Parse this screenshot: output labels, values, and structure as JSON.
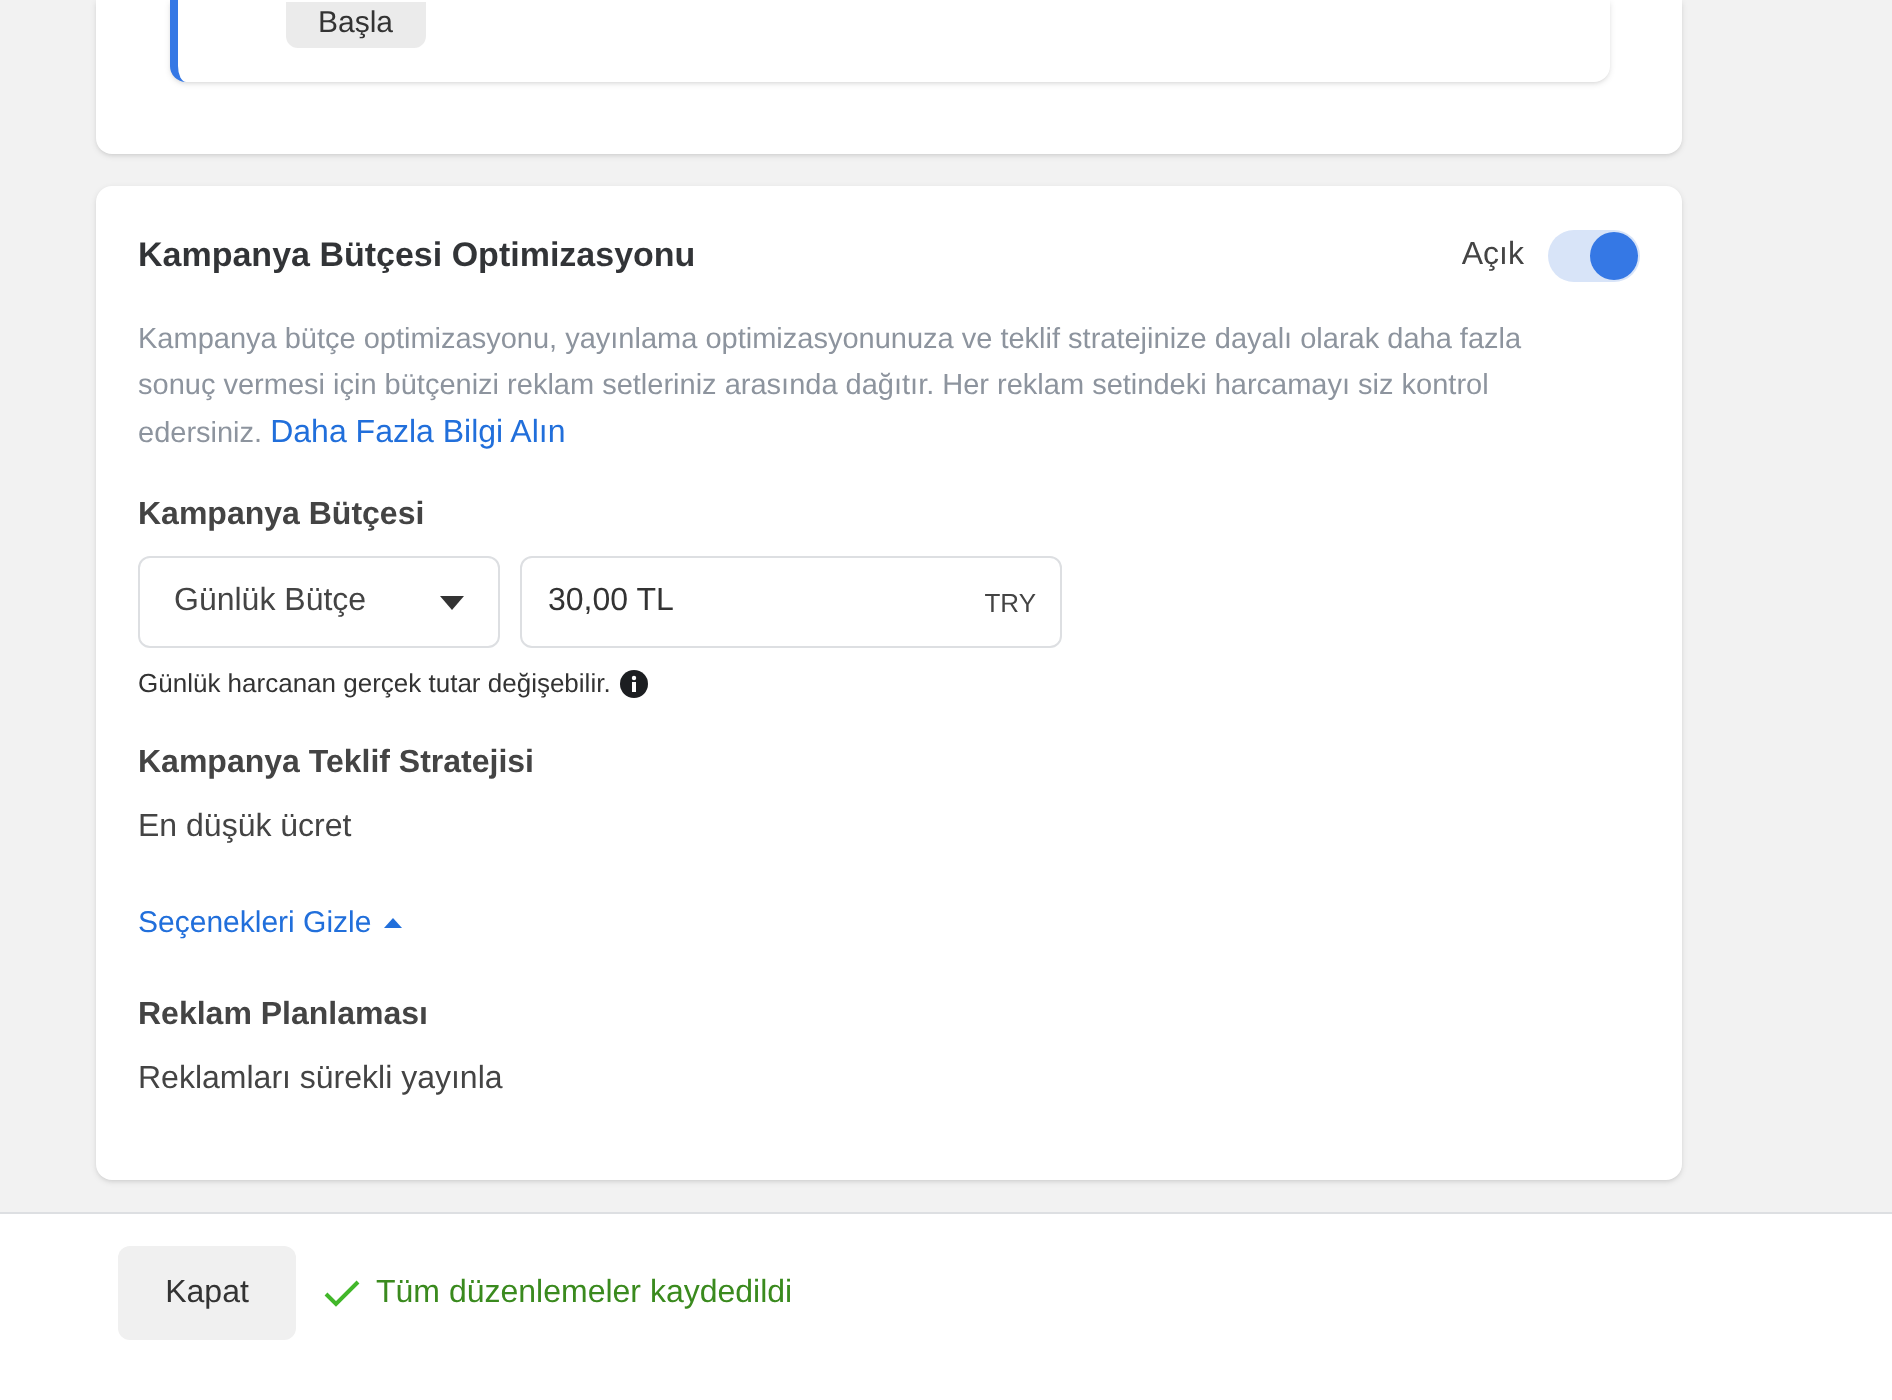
{
  "top_card": {
    "button": "Başla"
  },
  "optimization": {
    "title": "Kampanya Bütçesi Optimizasyonu",
    "toggle_label": "Açık",
    "on": true,
    "description": "Kampanya bütçe optimizasyonu, yayınlama optimizasyonunuza ve teklif stratejinize dayalı olarak daha fazla sonuç vermesi için bütçenizi reklam setleriniz arasında dağıtır. Her reklam setindeki harcamayı siz kontrol edersiniz.",
    "link": "Daha Fazla Bilgi Alın",
    "budget_label": "Kampanya Bütçesi",
    "budget_type": "Günlük Bütçe",
    "amount": "30,00 TL",
    "currency": "TRY",
    "budget_hint": "Günlük harcanan gerçek tutar değişebilir.",
    "bid_label": "Kampanya Teklif Stratejisi",
    "bid_value": "En düşük ücret",
    "options_link": "Seçenekleri Gizle",
    "options_expanded": true,
    "schedule_label": "Reklam Planlaması",
    "schedule_value": "Reklamları sürekli yayınla"
  },
  "footer": {
    "close": "Kapat",
    "status": "Tüm düzenlemeler kaydedildi"
  }
}
